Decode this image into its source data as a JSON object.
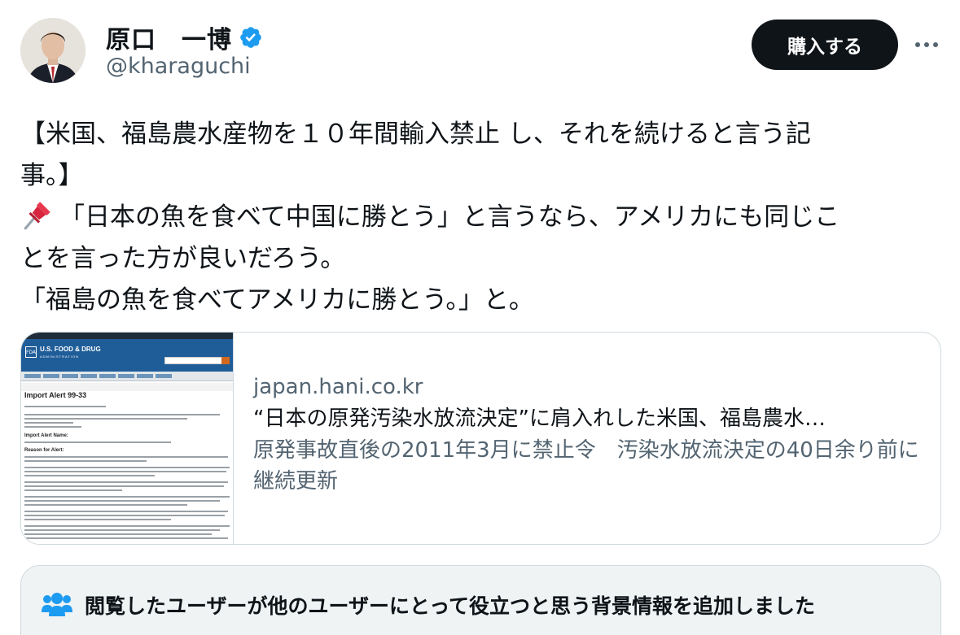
{
  "author": {
    "display_name": "原口　一博",
    "handle": "@kharaguchi"
  },
  "header": {
    "subscribe_label": "購入する"
  },
  "tweet": {
    "lines": [
      "【米国、福島農水産物を１０年間輸入禁止 し、それを続けると言う記",
      "事。】",
      "「日本の魚を食べて中国に勝とう」と言うなら、アメリカにも同じこ",
      "とを言った方が良いだろう。",
      "「福島の魚を食べてアメリカに勝とう。」と。"
    ]
  },
  "card": {
    "domain": "japan.hani.co.kr",
    "title": "“日本の原発汚染水放流決定”に肩入れした米国、福島農水…",
    "description": "原発事故直後の2011年3月に禁止令　汚染水放流決定の40日余り前に継続更新",
    "thumbnail": {
      "agency": "U.S. FOOD & DRUG",
      "agency_sub": "ADMINISTRATION",
      "logo": "FDA",
      "heading": "Import Alert 99-33",
      "section1": "Import Alert Name:",
      "section2": "Reason for Alert:"
    }
  },
  "community_note": {
    "text": "閲覧したユーザーが他のユーザーにとって役立つと思う背景情報を追加しました"
  },
  "colors": {
    "text": "#0f1419",
    "secondary": "#536471",
    "verified": "#1d9bf0",
    "border": "#cfd9de",
    "note_bg": "#eff3f4"
  },
  "icons": [
    "verified-badge-icon",
    "more-icon",
    "pushpin-icon",
    "people-icon"
  ]
}
